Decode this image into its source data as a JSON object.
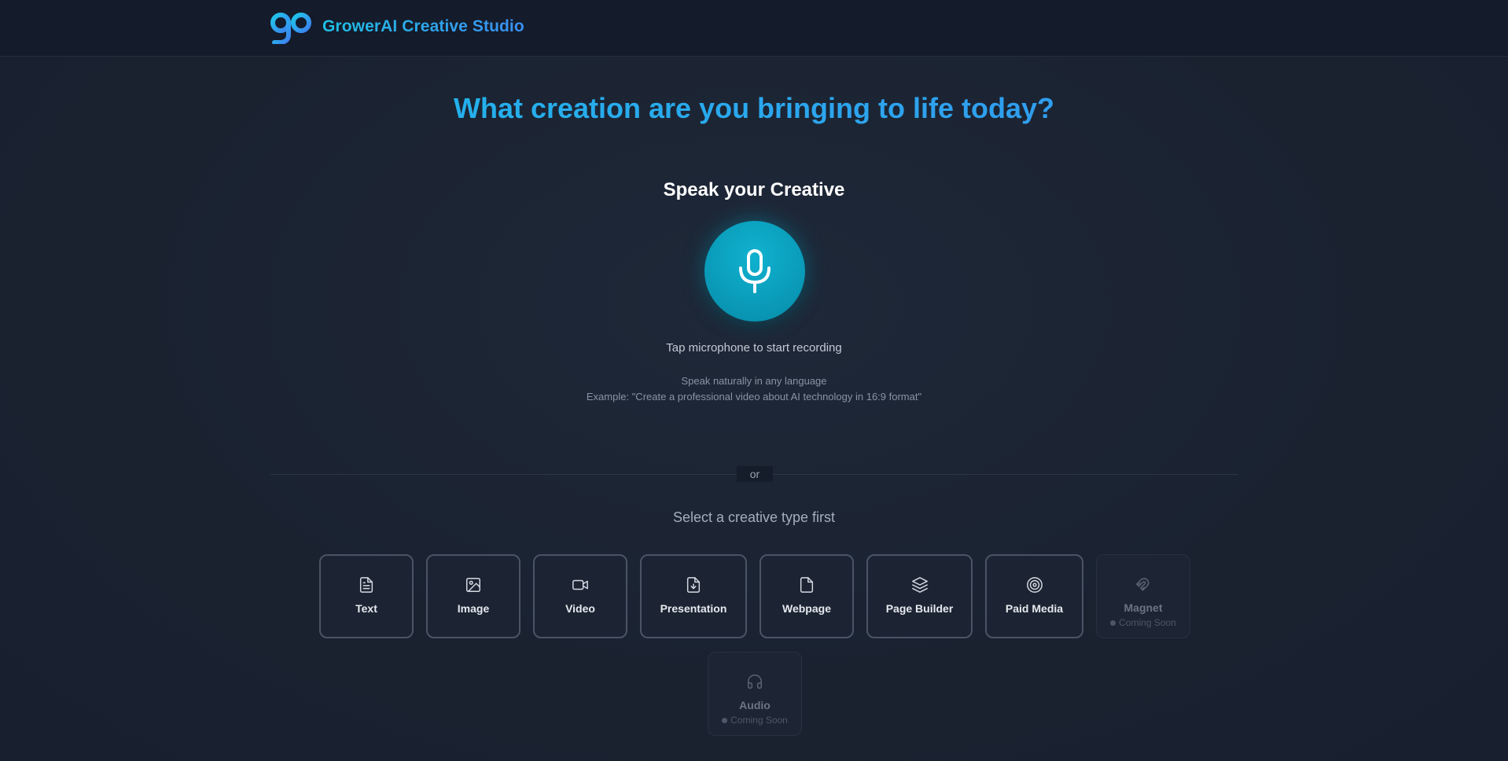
{
  "header": {
    "brand": "GrowerAI Creative Studio",
    "logo_icon": "gp-logo-icon"
  },
  "hero": {
    "headline": "What creation are you bringing to life today?"
  },
  "voice": {
    "title": "Speak your Creative",
    "mic_icon": "microphone-icon",
    "tap_text": "Tap microphone to start recording",
    "hint_language": "Speak naturally in any language",
    "hint_example": "Example: \"Create a professional video about AI technology in 16:9 format\""
  },
  "divider": {
    "label": "or"
  },
  "types": {
    "title": "Select a creative type first",
    "items": [
      {
        "label": "Text",
        "icon": "document-text-icon",
        "enabled": true
      },
      {
        "label": "Image",
        "icon": "image-icon",
        "enabled": true
      },
      {
        "label": "Video",
        "icon": "video-camera-icon",
        "enabled": true
      },
      {
        "label": "Presentation",
        "icon": "file-download-icon",
        "enabled": true
      },
      {
        "label": "Webpage",
        "icon": "file-icon",
        "enabled": true
      },
      {
        "label": "Page Builder",
        "icon": "layers-icon",
        "enabled": true
      },
      {
        "label": "Paid Media",
        "icon": "target-icon",
        "enabled": true
      },
      {
        "label": "Magnet",
        "icon": "magnet-icon",
        "enabled": false,
        "status": "Coming Soon"
      },
      {
        "label": "Audio",
        "icon": "headphones-icon",
        "enabled": false,
        "status": "Coming Soon"
      }
    ]
  },
  "colors": {
    "accent": "#1fc0e6",
    "accent_end": "#3b8ff0",
    "mic": "#0a9dbb",
    "background": "#1b2332",
    "topbar": "#141b2b"
  }
}
